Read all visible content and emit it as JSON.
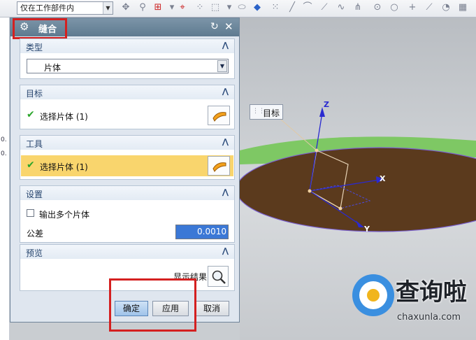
{
  "toolbar": {
    "filter_value": "仅在工作部件内"
  },
  "navigator": {
    "fragments": [
      "0.",
      "0."
    ]
  },
  "dialog": {
    "title": "缝合",
    "groups": {
      "type": {
        "title": "类型",
        "selected": "片体"
      },
      "target": {
        "title": "目标",
        "selection": "选择片体 (1)"
      },
      "tool": {
        "title": "工具",
        "selection": "选择片体 (1)"
      },
      "settings": {
        "title": "设置",
        "output_multiple": "输出多个片体",
        "tolerance_label": "公差",
        "tolerance_value": "0.0010"
      },
      "preview": {
        "title": "预览",
        "show_result": "显示结果"
      }
    },
    "buttons": {
      "ok": "确定",
      "apply": "应用",
      "cancel": "取消"
    }
  },
  "viewport": {
    "target_tag": "目标",
    "axis_z": "Z",
    "axis_x": "X",
    "axis_y": "Y"
  },
  "watermark": {
    "title": "查询啦",
    "url": "chaxunla.com"
  },
  "colors": {
    "highlight": "#d42020",
    "active_selection": "#f9d56d",
    "surface": "#5b3a1d",
    "surface_edge": "#7ec864",
    "axis": "#2a2ad0",
    "tolerance_field": "#3b78d6"
  }
}
